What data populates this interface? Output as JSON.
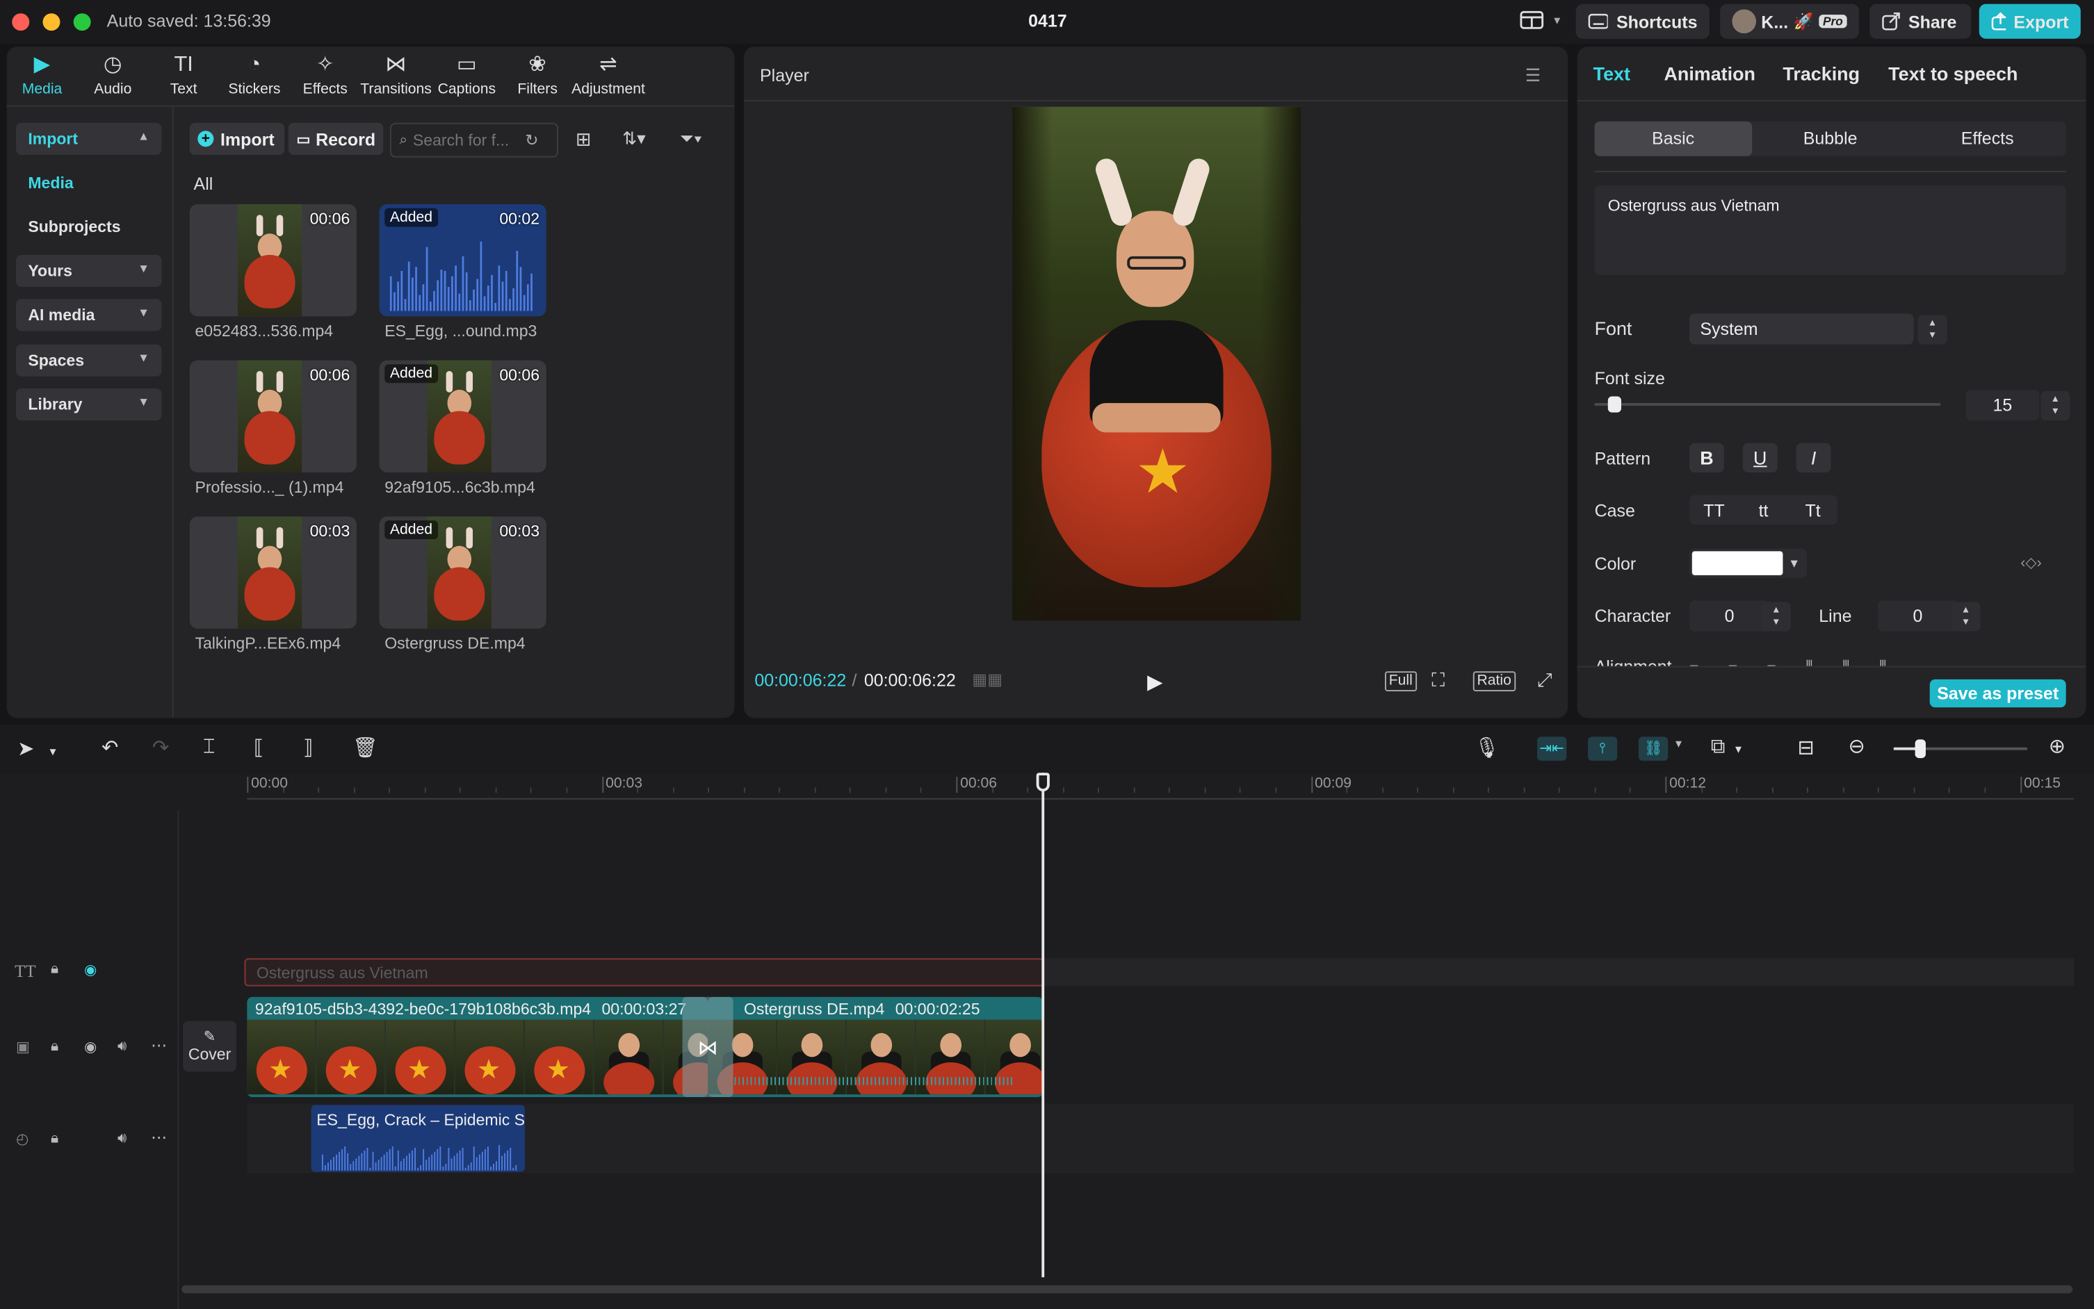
{
  "titlebar": {
    "autosave": "Auto saved: 13:56:39",
    "project_name": "0417",
    "shortcuts": "Shortcuts",
    "user": "K...",
    "pro_badge": "Pro",
    "share": "Share",
    "export": "Export"
  },
  "media_tabs": [
    {
      "label": "Media",
      "icon": "▶"
    },
    {
      "label": "Audio",
      "icon": "◷"
    },
    {
      "label": "Text",
      "icon": "TI"
    },
    {
      "label": "Stickers",
      "icon": "◔"
    },
    {
      "label": "Effects",
      "icon": "✧"
    },
    {
      "label": "Transitions",
      "icon": "⋈"
    },
    {
      "label": "Captions",
      "icon": "▭"
    },
    {
      "label": "Filters",
      "icon": "❀"
    },
    {
      "label": "Adjustment",
      "icon": "⇌"
    }
  ],
  "sidebar": {
    "import": "Import",
    "media": "Media",
    "subprojects": "Subprojects",
    "yours": "Yours",
    "ai_media": "AI media",
    "spaces": "Spaces",
    "library": "Library"
  },
  "media_toolbar": {
    "import": "Import",
    "record": "Record",
    "search_placeholder": "Search for f...",
    "all": "All"
  },
  "media_items": [
    {
      "name": "e052483...536.mp4",
      "duration": "00:06",
      "added": "",
      "kind": "video"
    },
    {
      "name": "ES_Egg, ...ound.mp3",
      "duration": "00:02",
      "added": "Added",
      "kind": "audio"
    },
    {
      "name": "Professio..._ (1).mp4",
      "duration": "00:06",
      "added": "",
      "kind": "video"
    },
    {
      "name": "92af9105...6c3b.mp4",
      "duration": "00:06",
      "added": "Added",
      "kind": "video"
    },
    {
      "name": "TalkingP...EEx6.mp4",
      "duration": "00:03",
      "added": "",
      "kind": "video"
    },
    {
      "name": "Ostergruss DE.mp4",
      "duration": "00:03",
      "added": "Added",
      "kind": "video"
    }
  ],
  "player": {
    "title": "Player",
    "current_time": "00:00:06:22",
    "total_time": "00:00:06:22",
    "full": "Full",
    "ratio": "Ratio"
  },
  "right_panel": {
    "tabs": [
      "Text",
      "Animation",
      "Tracking",
      "Text to speech"
    ],
    "subtabs": [
      "Basic",
      "Bubble",
      "Effects"
    ],
    "text_content": "Ostergruss aus Vietnam",
    "font_label": "Font",
    "font_value": "System",
    "font_size_label": "Font size",
    "font_size_value": "15",
    "font_size_fraction": 0.05,
    "pattern_label": "Pattern",
    "pattern_buttons": [
      "B",
      "U",
      "I"
    ],
    "case_label": "Case",
    "case_buttons": [
      "TT",
      "tt",
      "Tt"
    ],
    "color_label": "Color",
    "color_value": "#ffffff",
    "character_label": "Character",
    "character_value": "0",
    "line_label": "Line",
    "line_value": "0",
    "alignment_label": "Alignment",
    "save_preset": "Save as preset"
  },
  "timeline": {
    "ruler": [
      "00:00",
      "00:03",
      "00:06",
      "00:09",
      "00:12",
      "00:15"
    ],
    "text_clip": "Ostergruss aus Vietnam",
    "video_clip1_name": "92af9105-d5b3-4392-be0c-179b108b6c3b.mp4",
    "video_clip1_dur": "00:00:03:27",
    "video_clip2_name": "Ostergruss DE.mp4",
    "video_clip2_dur": "00:00:02:25",
    "audio_clip": "ES_Egg, Crack – Epidemic Sc",
    "cover": "Cover",
    "zoom_fraction": 0.2
  },
  "colors": {
    "accent": "#3dd8e4",
    "export_bg": "#1fb8c8",
    "video_track": "#1d6e72",
    "audio_clip": "#1c3a78",
    "text_clip_border": "#8a3434"
  }
}
